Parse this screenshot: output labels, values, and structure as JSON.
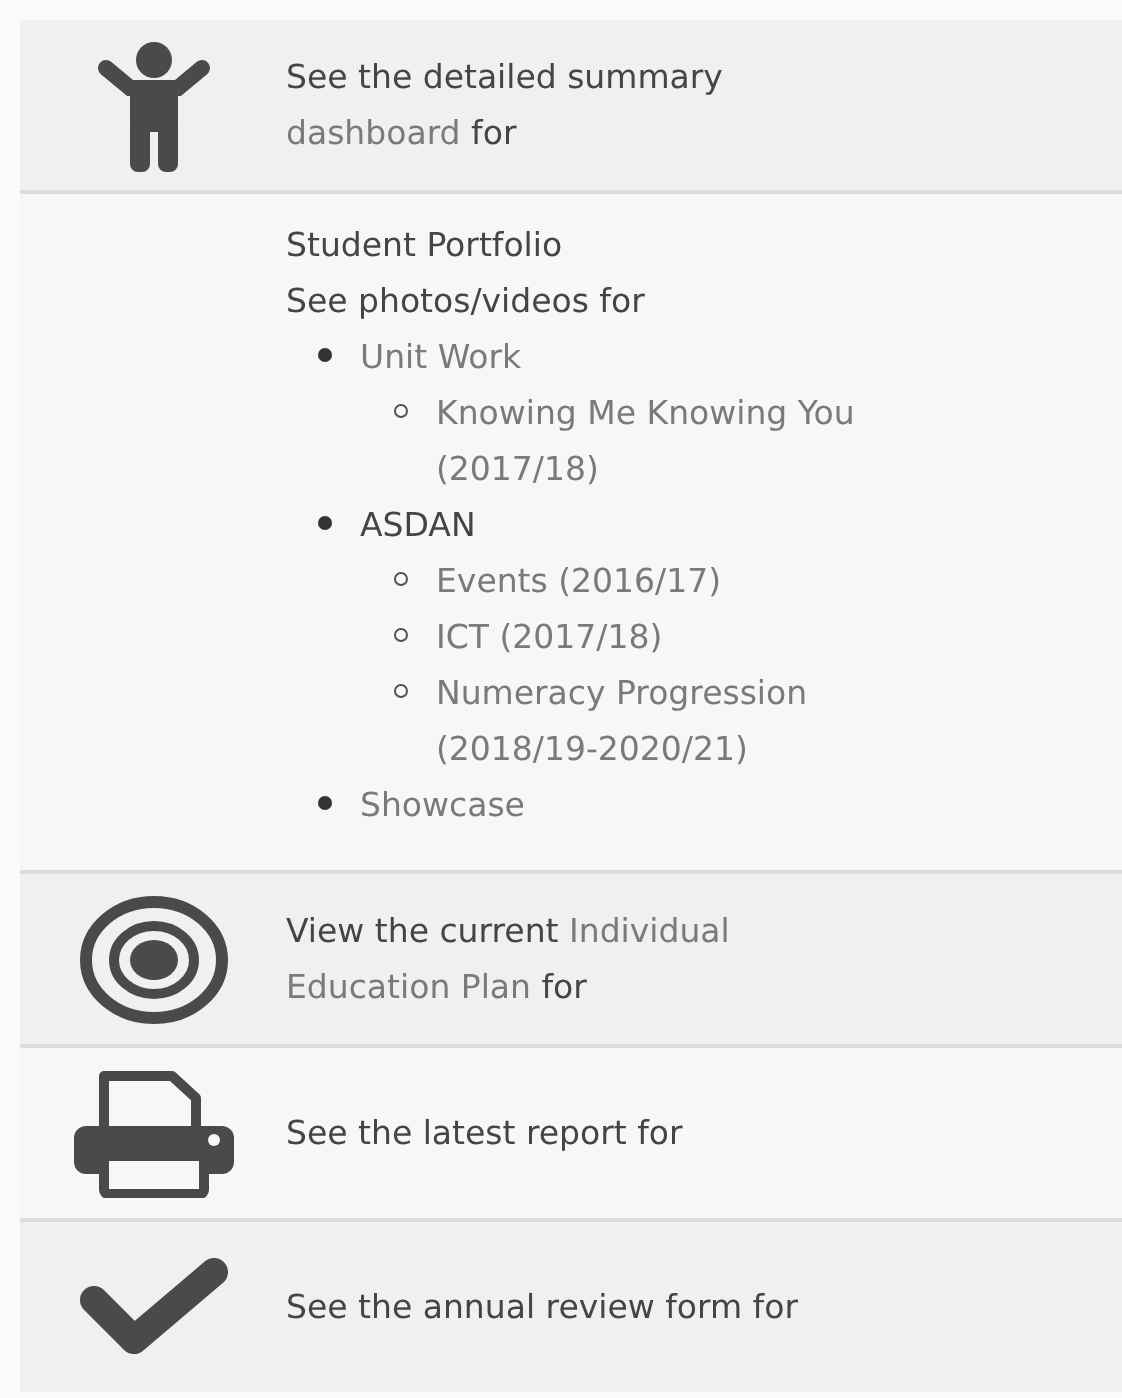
{
  "rows": [
    {
      "kind": "person",
      "segments": [
        {
          "text": "See the detailed summary",
          "kind": "plain"
        },
        {
          "text": "dashboard",
          "kind": "link"
        },
        {
          "text": "for",
          "kind": "plain"
        }
      ]
    },
    {
      "kind": "portfolio",
      "title": "Student Portfolio",
      "segments": [
        {
          "text": "See photos/videos for",
          "kind": "plain"
        }
      ],
      "items": [
        {
          "text": "Unit Work",
          "kind": "link",
          "children": [
            {
              "text": "Knowing Me Knowing You (2017/18)",
              "kind": "link"
            }
          ]
        },
        {
          "text": "ASDAN",
          "kind": "plain",
          "children": [
            {
              "text": "Events (2016/17)",
              "kind": "link"
            },
            {
              "text": "ICT (2017/18)",
              "kind": "link"
            },
            {
              "text": "Numeracy Progression (2018/19-2020/21)",
              "kind": "link"
            }
          ]
        },
        {
          "text": "Showcase",
          "kind": "link"
        }
      ]
    },
    {
      "kind": "target",
      "segments": [
        {
          "text": "View the current",
          "kind": "plain"
        },
        {
          "text": "Individual",
          "kind": "link"
        },
        {
          "text": "Education Plan",
          "kind": "link"
        },
        {
          "text": "for",
          "kind": "plain"
        }
      ]
    },
    {
      "kind": "printer",
      "segments": [
        {
          "text": "See the latest report for",
          "kind": "plain"
        }
      ]
    },
    {
      "kind": "check",
      "segments": [
        {
          "text": "See the annual review form for",
          "kind": "plain"
        }
      ]
    }
  ]
}
